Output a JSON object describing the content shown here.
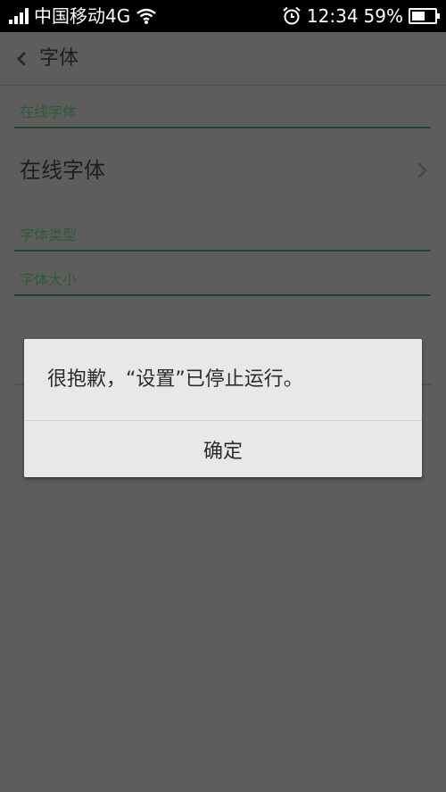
{
  "status_bar": {
    "carrier": "中国移动4G",
    "time": "12:34",
    "battery_percent": "59%",
    "battery_level": 0.59,
    "icons": [
      "signal-icon",
      "wifi-icon",
      "alarm-icon",
      "battery-icon"
    ]
  },
  "header": {
    "title": "字体",
    "back_icon": "chevron-left-icon"
  },
  "sections": {
    "online_font_header": "在线字体",
    "font_type_header": "字体类型",
    "font_size_header": "字体大小"
  },
  "rows": {
    "online_font_label": "在线字体",
    "chevron_icon": "chevron-right-icon"
  },
  "dialog": {
    "message": "很抱歉，“设置”已停止运行。",
    "ok_label": "确定"
  },
  "colors": {
    "status_bar_bg": "#000000",
    "dim_overlay_bg": "#5d5d5d",
    "section_accent": "#2f5a3a",
    "dialog_bg": "#e8e8e8",
    "text_dark": "#1e1e1e"
  }
}
